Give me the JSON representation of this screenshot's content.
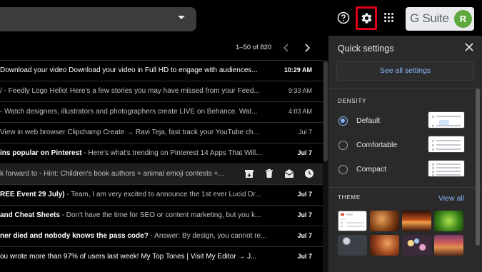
{
  "topbar": {
    "search_caret": "chevron-down-icon",
    "help_icon": "help-circle-icon",
    "settings_icon": "gear-icon",
    "highlight_color": "#e0001b",
    "apps_icon": "apps-grid-icon",
    "brand_g": "G",
    "brand_suite": " Suite",
    "avatar_initial": "R",
    "avatar_color": "#5fa83d"
  },
  "pager": {
    "range": "1–50 of 820",
    "prev_icon": "chevron-left-icon",
    "next_icon": "chevron-right-icon"
  },
  "emails": [
    {
      "lead": "",
      "snippet": "Download your video Download your video in Full HD to engage with audiences...",
      "date": "10:29 AM",
      "unread": true
    },
    {
      "lead": "",
      "snippet": "/ - Feedly Logo Hello! Here's a few stories you may have missed from your Feed...",
      "date": "9:33 AM",
      "unread": false
    },
    {
      "lead": "",
      "snippet": "- Watch designers, illustrators and photographers create LIVE on Behance. Wat...",
      "date": "4:03 AM",
      "unread": false
    },
    {
      "lead": "",
      "snippet": "View in web browser Clipchamp Create → Ravi Teja, fast track your YouTube ch...",
      "date": "Jul 7",
      "unread": false
    },
    {
      "lead": "ins popular on Pinterest",
      "snippet": " - Here's what's trending on Pinterest 14 Apps That Will...",
      "date": "Jul 7",
      "unread": true
    },
    {
      "lead": "",
      "snippet": "k forward to - Hint: Children's book authors + animal emoji contests +...",
      "date": "",
      "unread": false,
      "hover": true
    },
    {
      "lead": "REE Event 29 July)",
      "snippet": " - Team, I am very excited to announce the 1st ever Lucid Dr...",
      "date": "Jul 7",
      "unread": true
    },
    {
      "lead": " and Cheat Sheets",
      "snippet": " - Don't have the time for SEO or content marketing, but you k...",
      "date": "Jul 7",
      "unread": true
    },
    {
      "lead": "ner died and nobody knows the pass code?",
      "snippet": " - Answer: By design, you cannot re...",
      "date": "Jul 7",
      "unread": true
    },
    {
      "lead": "",
      "snippet": "ou wrote more than 97% of users last week! My Top Tones | Visit My Editor → J...",
      "date": "Jul 7",
      "unread": true
    }
  ],
  "hover_actions": [
    "archive-icon",
    "delete-icon",
    "mark-read-icon",
    "snooze-icon"
  ],
  "quick_settings": {
    "title": "Quick settings",
    "close_icon": "close-icon",
    "see_all": "See all settings",
    "density_heading": "DENSITY",
    "density_options": [
      {
        "label": "Default",
        "checked": true
      },
      {
        "label": "Comfortable",
        "checked": false
      },
      {
        "label": "Compact",
        "checked": false
      }
    ],
    "theme_heading": "THEME",
    "view_all": "View all",
    "themes": [
      {
        "name": "default-theme-thumbnail"
      },
      {
        "name": "canyon-theme-thumbnail"
      },
      {
        "name": "sunset-theme-thumbnail"
      },
      {
        "name": "leaf-theme-thumbnail"
      },
      {
        "name": "pebbles-theme-thumbnail"
      },
      {
        "name": "autumn-theme-thumbnail"
      },
      {
        "name": "bokeh-theme-thumbnail"
      },
      {
        "name": "desert-theme-thumbnail"
      }
    ],
    "accent_color": "#8ab4f8"
  }
}
